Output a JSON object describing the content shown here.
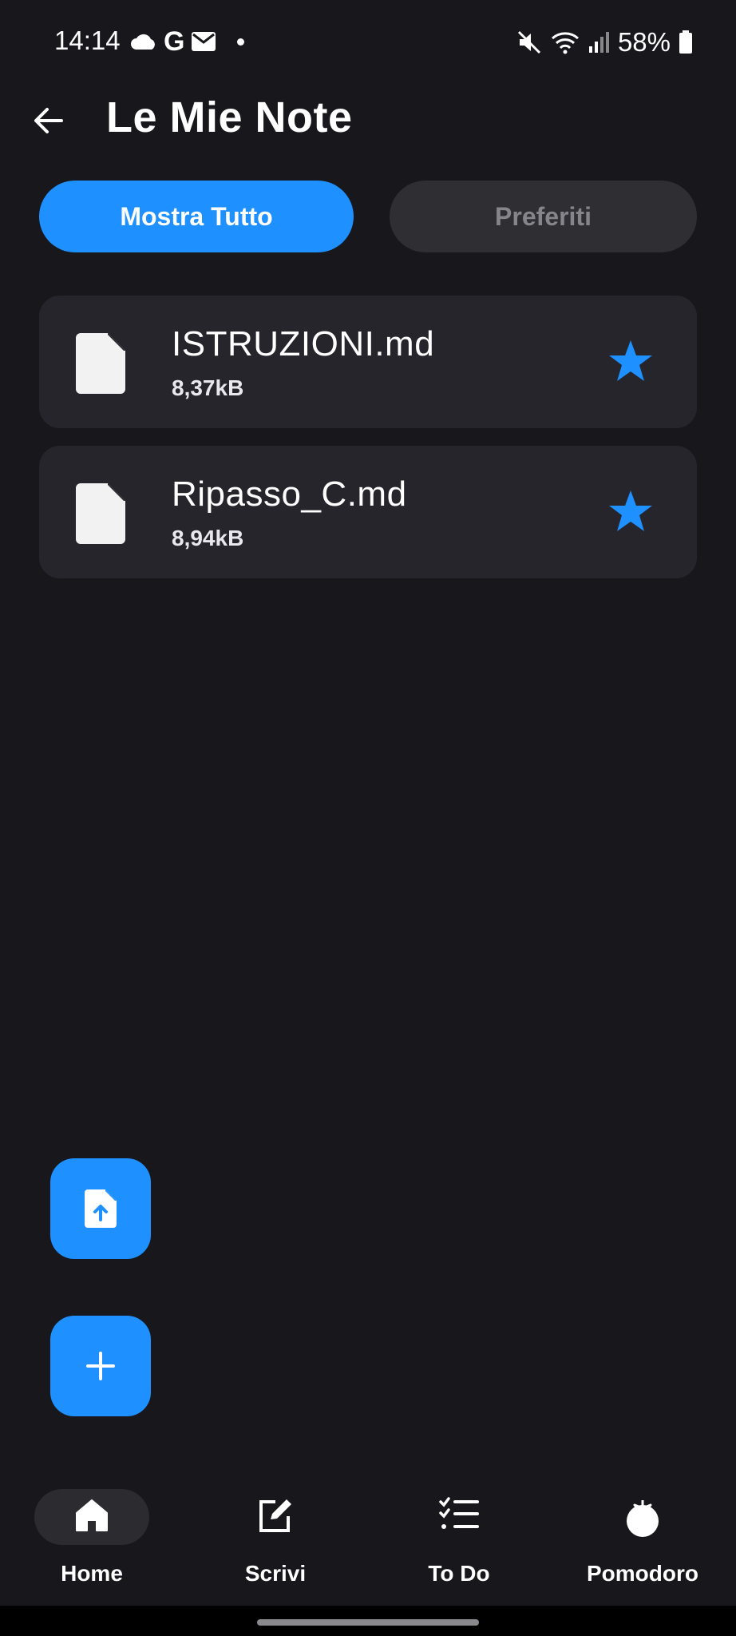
{
  "status_bar": {
    "time": "14:14",
    "battery": "58%",
    "left_icons": [
      "cloud-icon",
      "google-icon",
      "mail-icon",
      "notification-dot"
    ],
    "right_icons": [
      "mute-icon",
      "wifi-icon",
      "signal-icon",
      "battery-icon"
    ],
    "google_glyph": "G"
  },
  "app_bar": {
    "title": "Le Mie Note",
    "back_icon": "arrow-left-icon"
  },
  "filters": {
    "all_label": "Mostra Tutto",
    "favorites_label": "Preferiti",
    "active": "all"
  },
  "notes": [
    {
      "name": "ISTRUZIONI.md",
      "size": "8,37kB",
      "favorite": true
    },
    {
      "name": "Ripasso_C.md",
      "size": "8,94kB",
      "favorite": true
    }
  ],
  "fabs": {
    "upload_icon": "file-upload-icon",
    "add_icon": "plus-icon"
  },
  "bottom_nav": {
    "items": [
      {
        "label": "Home",
        "icon": "home-icon",
        "active": true
      },
      {
        "label": "Scrivi",
        "icon": "edit-icon",
        "active": false
      },
      {
        "label": "To Do",
        "icon": "checklist-icon",
        "active": false
      },
      {
        "label": "Pomodoro",
        "icon": "tomato-icon",
        "active": false
      }
    ]
  },
  "colors": {
    "background": "#18181c",
    "accent": "#1e90ff",
    "card": "#25252b",
    "inactive_chip": "#2e2e33"
  }
}
